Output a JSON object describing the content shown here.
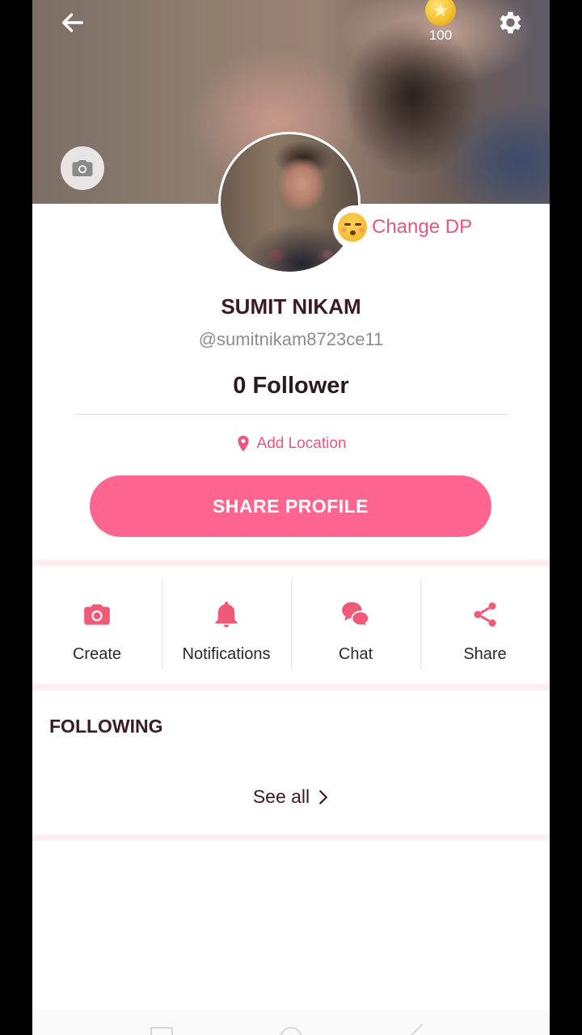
{
  "header": {
    "coins": "100"
  },
  "profile": {
    "change_dp_label": "Change DP",
    "name": "SUMIT NIKAM",
    "handle": "@sumitnikam8723ce11",
    "followers": "0 Follower",
    "location_label": "Add Location",
    "share_button_label": "SHARE PROFILE"
  },
  "actions": [
    {
      "label": "Create",
      "icon": "camera-icon"
    },
    {
      "label": "Notifications",
      "icon": "bell-icon"
    },
    {
      "label": "Chat",
      "icon": "chat-bubbles-icon"
    },
    {
      "label": "Share",
      "icon": "share-icon"
    }
  ],
  "following": {
    "title": "FOLLOWING",
    "see_all_label": "See all"
  },
  "colors": {
    "accent": "#ff6590",
    "accent_text": "#e8577f",
    "dark_text": "#3b1a24"
  }
}
